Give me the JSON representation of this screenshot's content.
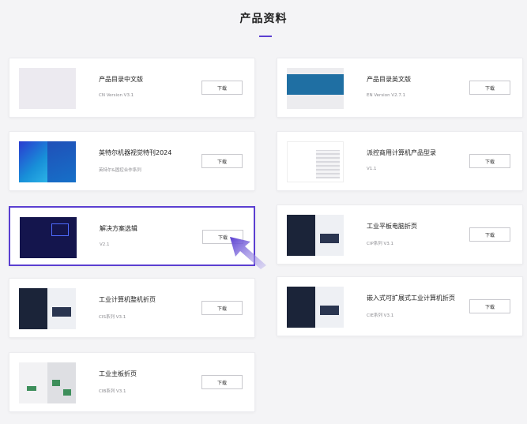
{
  "section": {
    "title": "产品资料"
  },
  "colors": {
    "accent": "#5b3fd1",
    "page_bg": "#f4f4f6"
  },
  "cards": [
    {
      "title": "产品目录中文版",
      "subtitle": "CN Version V3.1",
      "button": "下载",
      "thumb": "light-brochure"
    },
    {
      "title": "产品目录英文版",
      "subtitle": "EN Version V2.7.1",
      "button": "下载",
      "thumb": "teal-banner-brochure"
    },
    {
      "title": "英特尔机器视觉特刊2024",
      "subtitle": "英特尔&固控合作系列",
      "button": "下载",
      "thumb": "blue-multi-panel-brochure"
    },
    {
      "title": "派控商用计算机产品型录",
      "subtitle": "V1.1",
      "button": "下载",
      "thumb": "white-striped-brochure"
    },
    {
      "title": "解决方案选辑",
      "subtitle": "V2.1",
      "button": "下载",
      "thumb": "navy-brochure"
    },
    {
      "title": "工业平板电脑折页",
      "subtitle": "CIP系列 V3.1",
      "button": "下载",
      "thumb": "split-tablet-brochure"
    },
    {
      "title": "工业计算机整机折页",
      "subtitle": "CIS系列 V3.1",
      "button": "下载",
      "thumb": "split-computer-brochure"
    },
    {
      "title": "嵌入式可扩展式工业计算机折页",
      "subtitle": "CIE系列 V3.1",
      "button": "下载",
      "thumb": "split-embedded-brochure"
    },
    {
      "title": "工业主板折页",
      "subtitle": "CIB系列 V3.1",
      "button": "下载",
      "thumb": "board-brochure"
    }
  ],
  "cursor": {
    "icon": "pointer-arrow-icon"
  }
}
